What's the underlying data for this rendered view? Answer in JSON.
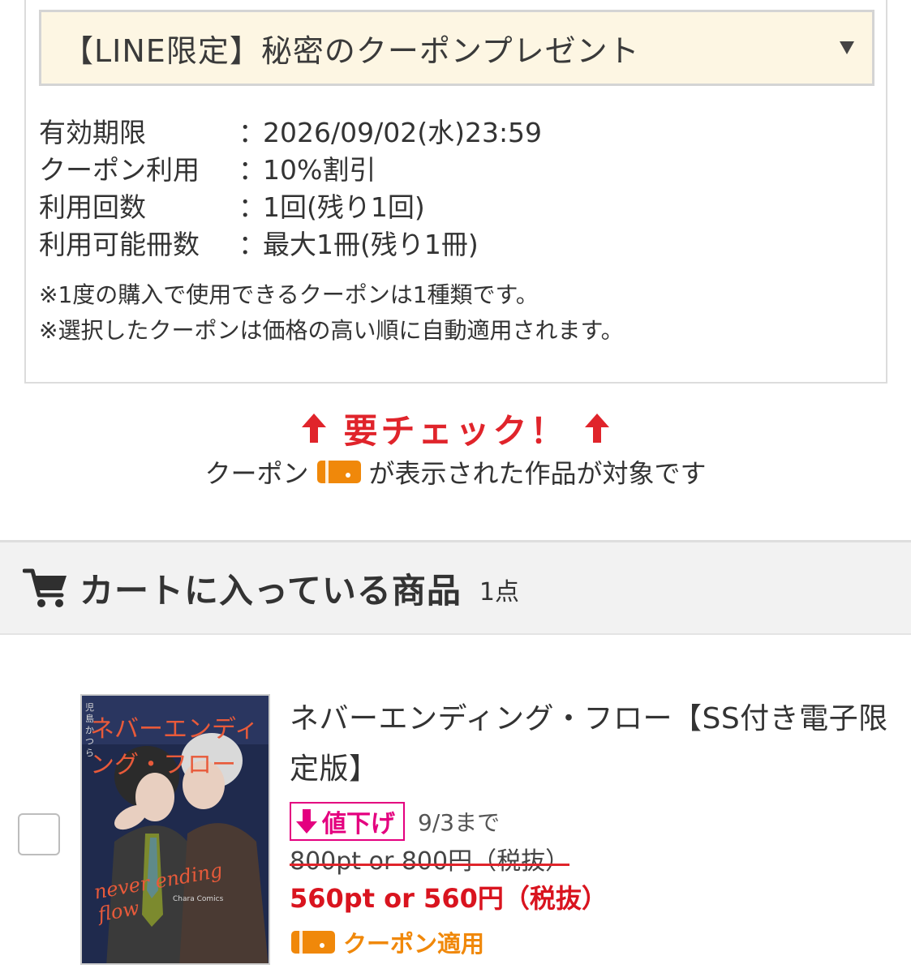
{
  "coupon": {
    "title": "【LINE限定】秘密のクーポンプレゼント",
    "details": [
      {
        "label": "有効期限",
        "value": "2026/09/02(水)23:59"
      },
      {
        "label": "クーポン利用",
        "value": "10%割引"
      },
      {
        "label": "利用回数",
        "value": "1回(残り1回)"
      },
      {
        "label": "利用可能冊数",
        "value": "最大1冊(残り1冊)"
      }
    ],
    "notes": [
      "※1度の購入で使用できるクーポンは1種類です。",
      "※選択したクーポンは価格の高い順に自動適用されます。"
    ]
  },
  "check": {
    "title": "要チェック！",
    "sub_before": "クーポン",
    "sub_after": "が表示された作品が対象です"
  },
  "cart": {
    "title": "カートに入っている商品",
    "count": "1点"
  },
  "product": {
    "title": "ネバーエンディング・フロー【SS付き電子限定版】",
    "sale_badge": "値下げ",
    "sale_until": "9/3まで",
    "old_price": "800pt or 800円（税抜）",
    "new_price": "560pt or 560円（税抜）",
    "coupon_applied": "クーポン適用",
    "cover": {
      "title_jp": "ネバーエンディング・フロー",
      "title_en": "never ending flow",
      "author": "児島かつら",
      "label": "Chara Comics"
    }
  },
  "colors": {
    "accent_red": "#e0242b",
    "sale_pink": "#e4007f",
    "coupon_orange": "#f0880a",
    "coupon_bg": "#fdf6e3"
  }
}
